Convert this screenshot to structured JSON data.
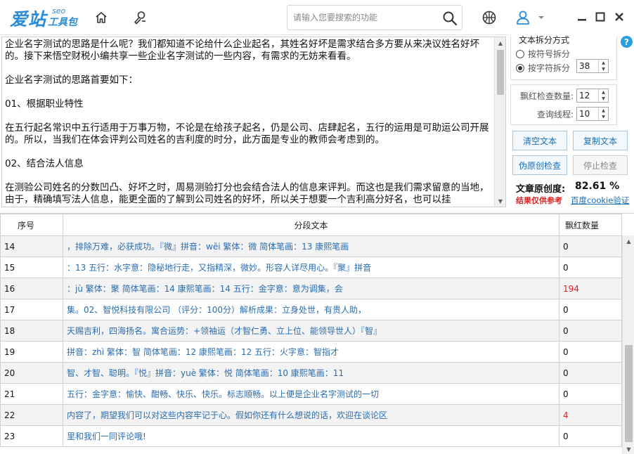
{
  "app": {
    "logo_main": "爱站",
    "logo_seo": "seo",
    "logo_sub": "工具包"
  },
  "search": {
    "placeholder": "请输入您要搜索的功能"
  },
  "editor": {
    "paragraphs": [
      "企业名字测试的思路是什么呢？我们都知道不论给什么企业起名，其姓名好坏是需求结合多方要从来决议姓名好坏的。接下来悟空财税小编共享一些企业名字测试的一些内容，有需求的无妨来看看。",
      "企业名字测试的思路首要如下：",
      "01、根据职业特性",
      "在五行起名常识中五行适用于万事万物，不论是在给孩子起名，仍是公司、店肆起名，五行的运用是可助运公司开展的。所以，当我们在体会评判公司姓名的吉利度的时分，此方面是专业的教师会考虑到的。",
      "02、结合法人信息",
      "在测验公司姓名的分数凹凸、好坏之时，周易测验打分也会结合法人的信息来评判。而这也是我们需求留意的当地，由于，精确填写法人信息，能更全面的了解到公司姓名的好坏，所以关于想要一个吉利高分好名，也可以挂"
    ]
  },
  "options": {
    "split_title": "文本拆分方式",
    "split_by_symbol": "按符号拆分",
    "split_by_char": "按字符拆分",
    "split_char_count": "38",
    "check_count_label": "飘红检查数量:",
    "check_count": "12",
    "threads_label": "查询线程:",
    "threads": "10",
    "btn_clear": "清空文本",
    "btn_copy": "复制文本",
    "btn_check": "伪原创检查",
    "btn_stop": "停止检查",
    "originality_label": "文章原创度:",
    "originality_value": "82.61 %",
    "note": "结果仅供参考",
    "cookie_link": "百度cookie验证"
  },
  "table": {
    "headers": [
      "序号",
      "分段文本",
      "飘红数量"
    ],
    "rows": [
      {
        "idx": "14",
        "text": "，排除万难，必获成功。『微』拼音：wēi 繁体：微 简体笔画：13 康熙笔画",
        "count": "0"
      },
      {
        "idx": "15",
        "text": "：13 五行：水字意：隐秘地行走，又指精深，微妙。形容人详尽用心。『聚』拼音",
        "count": "0"
      },
      {
        "idx": "16",
        "text": "：jù 繁体：聚 简体笔画：14 康熙笔画：14 五行：金字意：意为调集，会",
        "count": "194"
      },
      {
        "idx": "17",
        "text": "集。02、智悦科技有限公司 （评分：100分）解析成果：立身处世，有贵人助，",
        "count": "0"
      },
      {
        "idx": "18",
        "text": "天赐吉利，四海扬名。寓合运势：+领袖运（才智仁勇、立上位、能领导世人）『智』",
        "count": "0"
      },
      {
        "idx": "19",
        "text": "拼音：zhì 繁体：智 简体笔画：12 康熙笔画：12 五行：火字意：智指才",
        "count": "0"
      },
      {
        "idx": "20",
        "text": "智、才智、聪明。『悦』拼音：yuè 繁体：悦 简体笔画：10 康熙笔画：11",
        "count": "0"
      },
      {
        "idx": "21",
        "text": "五行：金字意：愉快、酣畅、快乐、快乐。标志顺畅。以上便是企业名字测试的一切",
        "count": "0"
      },
      {
        "idx": "22",
        "text": "内容了，期望我们可以对这些内容牢记于心。假如你还有什么想说的话，欢迎在谈论区",
        "count": "4"
      },
      {
        "idx": "23",
        "text": "里和我们一同评论哦!",
        "count": "0"
      }
    ]
  },
  "colors": {
    "brand": "#2a8bd6",
    "link": "#2a6db0",
    "warning": "#e02020"
  },
  "icons": {
    "home": "home-icon",
    "tools": "tools-icon",
    "search": "search-icon",
    "skin": "basketball-icon",
    "user": "user-icon",
    "dropdown": "caret-down-icon",
    "minimize": "minimize-icon",
    "maximize": "maximize-icon",
    "close": "close-icon",
    "help": "help-icon"
  }
}
